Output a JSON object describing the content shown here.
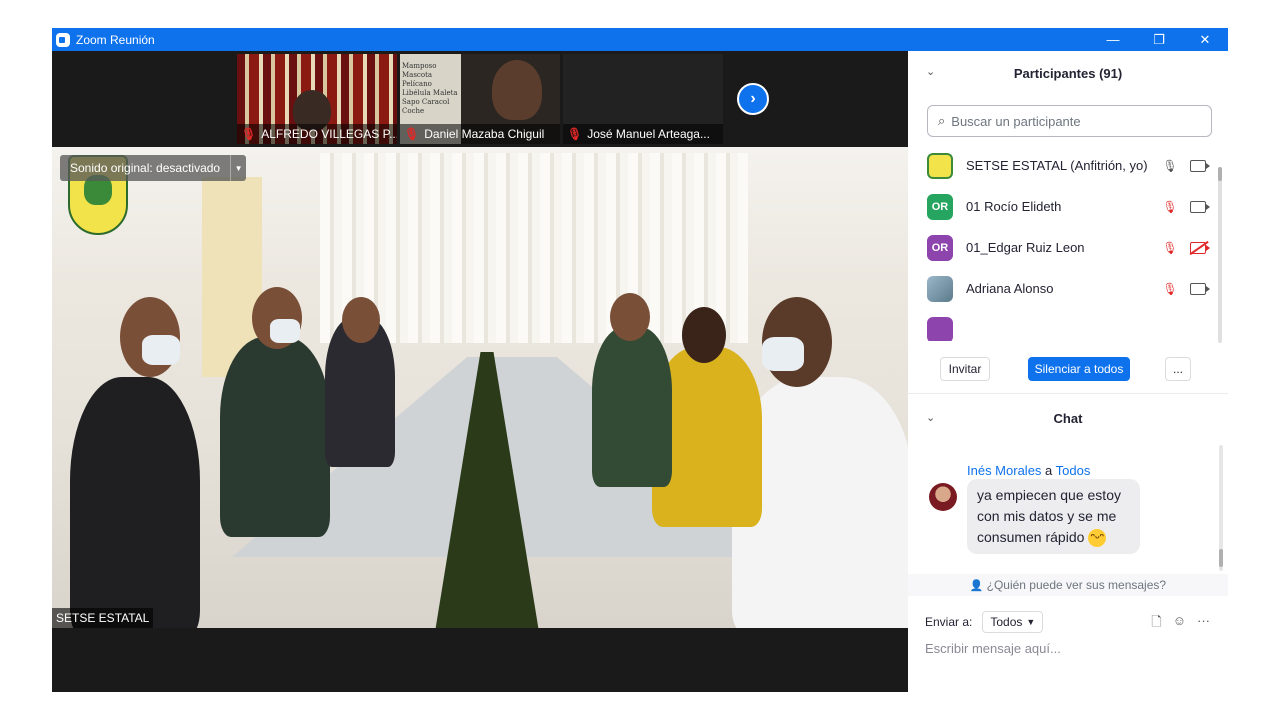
{
  "window": {
    "title": "Zoom Reunión",
    "controls": [
      "—",
      "❐",
      "✕"
    ]
  },
  "gallery_strip": {
    "thumbnails": [
      {
        "name": "ALFREDO VILLEGAS P...",
        "muted": true
      },
      {
        "name": "Daniel Mazaba Chiguil",
        "muted": true,
        "notes": "Mamposo Mascota Pelícano Libélula Maleta Sapo Caracol Coche"
      },
      {
        "name": "José Manuel Arteaga...",
        "muted": true
      }
    ],
    "next_icon": "chevron-right-icon"
  },
  "main_video": {
    "audio_status": "Sonido original: desactivado",
    "speaker_name": "SETSE ESTATAL"
  },
  "participants": {
    "title": "Participantes (91)",
    "search_placeholder": "Buscar un participante",
    "items": [
      {
        "name": "SETSE ESTATAL (Anfitrión, yo)",
        "avatar": "logo",
        "mic_muted": false,
        "video_off": false
      },
      {
        "name": "01 Rocío Elideth",
        "avatar": "OR",
        "avatar_color": "#25a55f",
        "mic_muted": true,
        "video_off": false
      },
      {
        "name": "01_Edgar Ruiz Leon",
        "avatar": "OR",
        "avatar_color": "#8e44ad",
        "mic_muted": true,
        "video_off": true
      },
      {
        "name": "Adriana Alonso",
        "avatar": "photo",
        "mic_muted": true,
        "video_off": false
      }
    ],
    "buttons": {
      "invite": "Invitar",
      "mute_all": "Silenciar a todos",
      "more": "..."
    }
  },
  "chat": {
    "title": "Chat",
    "messages": [
      {
        "from": "Inés Morales",
        "to_word": "a",
        "to": "Todos",
        "text": "ya empiecen que estoy con mis datos y se me consumen rápido",
        "emoji": "grinning-sweat-emoji"
      }
    ],
    "who_can_see": "¿Quién puede ver sus mensajes?",
    "send_to_label": "Enviar a:",
    "send_to_value": "Todos",
    "compose_placeholder": "Escribir mensaje aquí..."
  },
  "colors": {
    "accent": "#0e72ed",
    "muted_red": "#e02828",
    "titlebar": "#0e72ed"
  }
}
